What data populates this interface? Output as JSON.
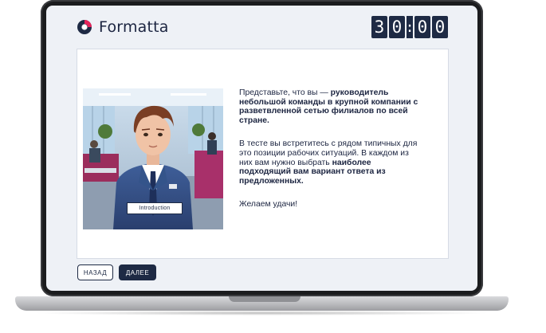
{
  "header": {
    "logo_text": "Formatta",
    "timer": {
      "d1": "3",
      "d2": "0",
      "sep": ":",
      "d3": "0",
      "d4": "0"
    }
  },
  "content": {
    "illustration_label": "Introduction",
    "p1_a": "Представьте, что вы — ",
    "p1_b": "руководитель небольшой команды в крупной компании с разветвленной сетью филиалов по всей стране.",
    "p2_a": "В тесте вы встретитесь с рядом типичных для это позиции рабочих ситуаций. В каждом из них вам нужно выбрать ",
    "p2_b": "наиболее подходящий вам вариант ответа из предложенных.",
    "p3": "Желаем удачи!"
  },
  "buttons": {
    "back": "НАЗАД",
    "next": "ДАЛЕЕ"
  },
  "colors": {
    "brand": "#1e2a44",
    "accent": "#e5245a",
    "background": "#eef1f6"
  }
}
